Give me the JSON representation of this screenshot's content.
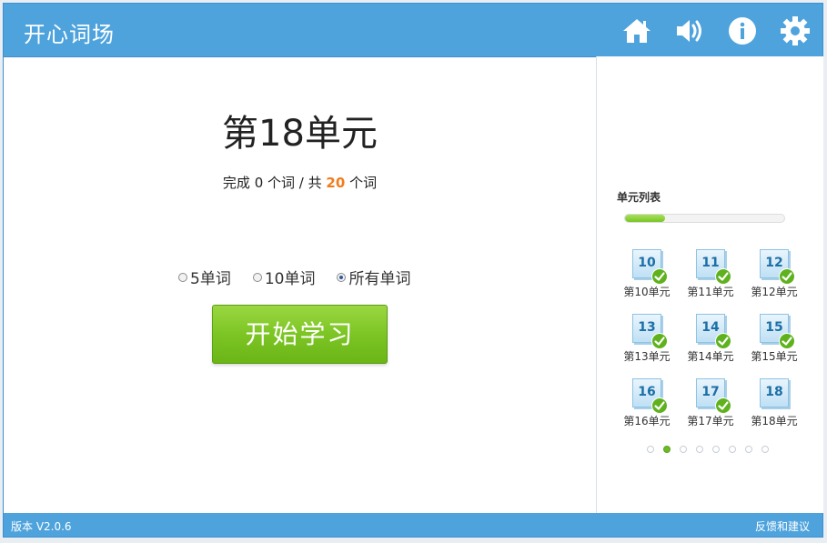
{
  "app": {
    "title": "开心词场"
  },
  "toolbar": {
    "icons": [
      "home-icon",
      "volume-icon",
      "info-icon",
      "gear-icon"
    ]
  },
  "main": {
    "unit_title": "第18单元",
    "progress": {
      "prefix": "完成",
      "done": "0",
      "middle": "个词 / 共",
      "total": "20",
      "suffix": "个词"
    },
    "options": [
      {
        "label": "5单词",
        "checked": false
      },
      {
        "label": "10单词",
        "checked": false
      },
      {
        "label": "所有单词",
        "checked": true
      }
    ],
    "start_label": "开始学习"
  },
  "sidebar": {
    "title": "单元列表",
    "progress_fraction": 0.25,
    "units": [
      {
        "num": "10",
        "label": "第10单元",
        "done": true
      },
      {
        "num": "11",
        "label": "第11单元",
        "done": true
      },
      {
        "num": "12",
        "label": "第12单元",
        "done": true
      },
      {
        "num": "13",
        "label": "第13单元",
        "done": true
      },
      {
        "num": "14",
        "label": "第14单元",
        "done": true
      },
      {
        "num": "15",
        "label": "第15单元",
        "done": true
      },
      {
        "num": "16",
        "label": "第16单元",
        "done": true
      },
      {
        "num": "17",
        "label": "第17单元",
        "done": true
      },
      {
        "num": "18",
        "label": "第18单元",
        "done": false
      }
    ],
    "pages": 8,
    "active_page": 2
  },
  "status": {
    "version": "版本 V2.0.6",
    "feedback": "反馈和建议"
  },
  "colors": {
    "accent": "#4ea3dd",
    "highlight": "#f07d1d",
    "green": "#7cc524"
  }
}
